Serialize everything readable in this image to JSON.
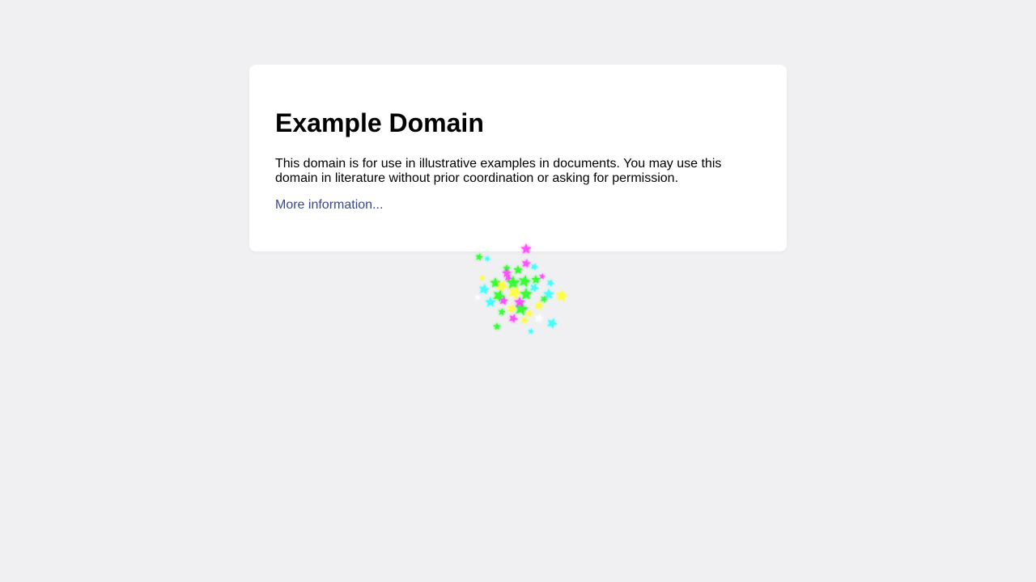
{
  "page": {
    "heading": "Example Domain",
    "description": "This domain is for use in illustrative examples in documents. You may use this domain in literature without prior coordination or asking for permission.",
    "link_text": "More information..."
  },
  "colors": {
    "background": "#f0f0f2",
    "card": "#ffffff",
    "link": "#38488f",
    "sparkle_palette": [
      "#ff40ff",
      "#22ff22",
      "#33ffff",
      "#ffff33",
      "#ffffff"
    ]
  },
  "icons": {
    "sparkle_cluster": "star-burst-icon"
  }
}
